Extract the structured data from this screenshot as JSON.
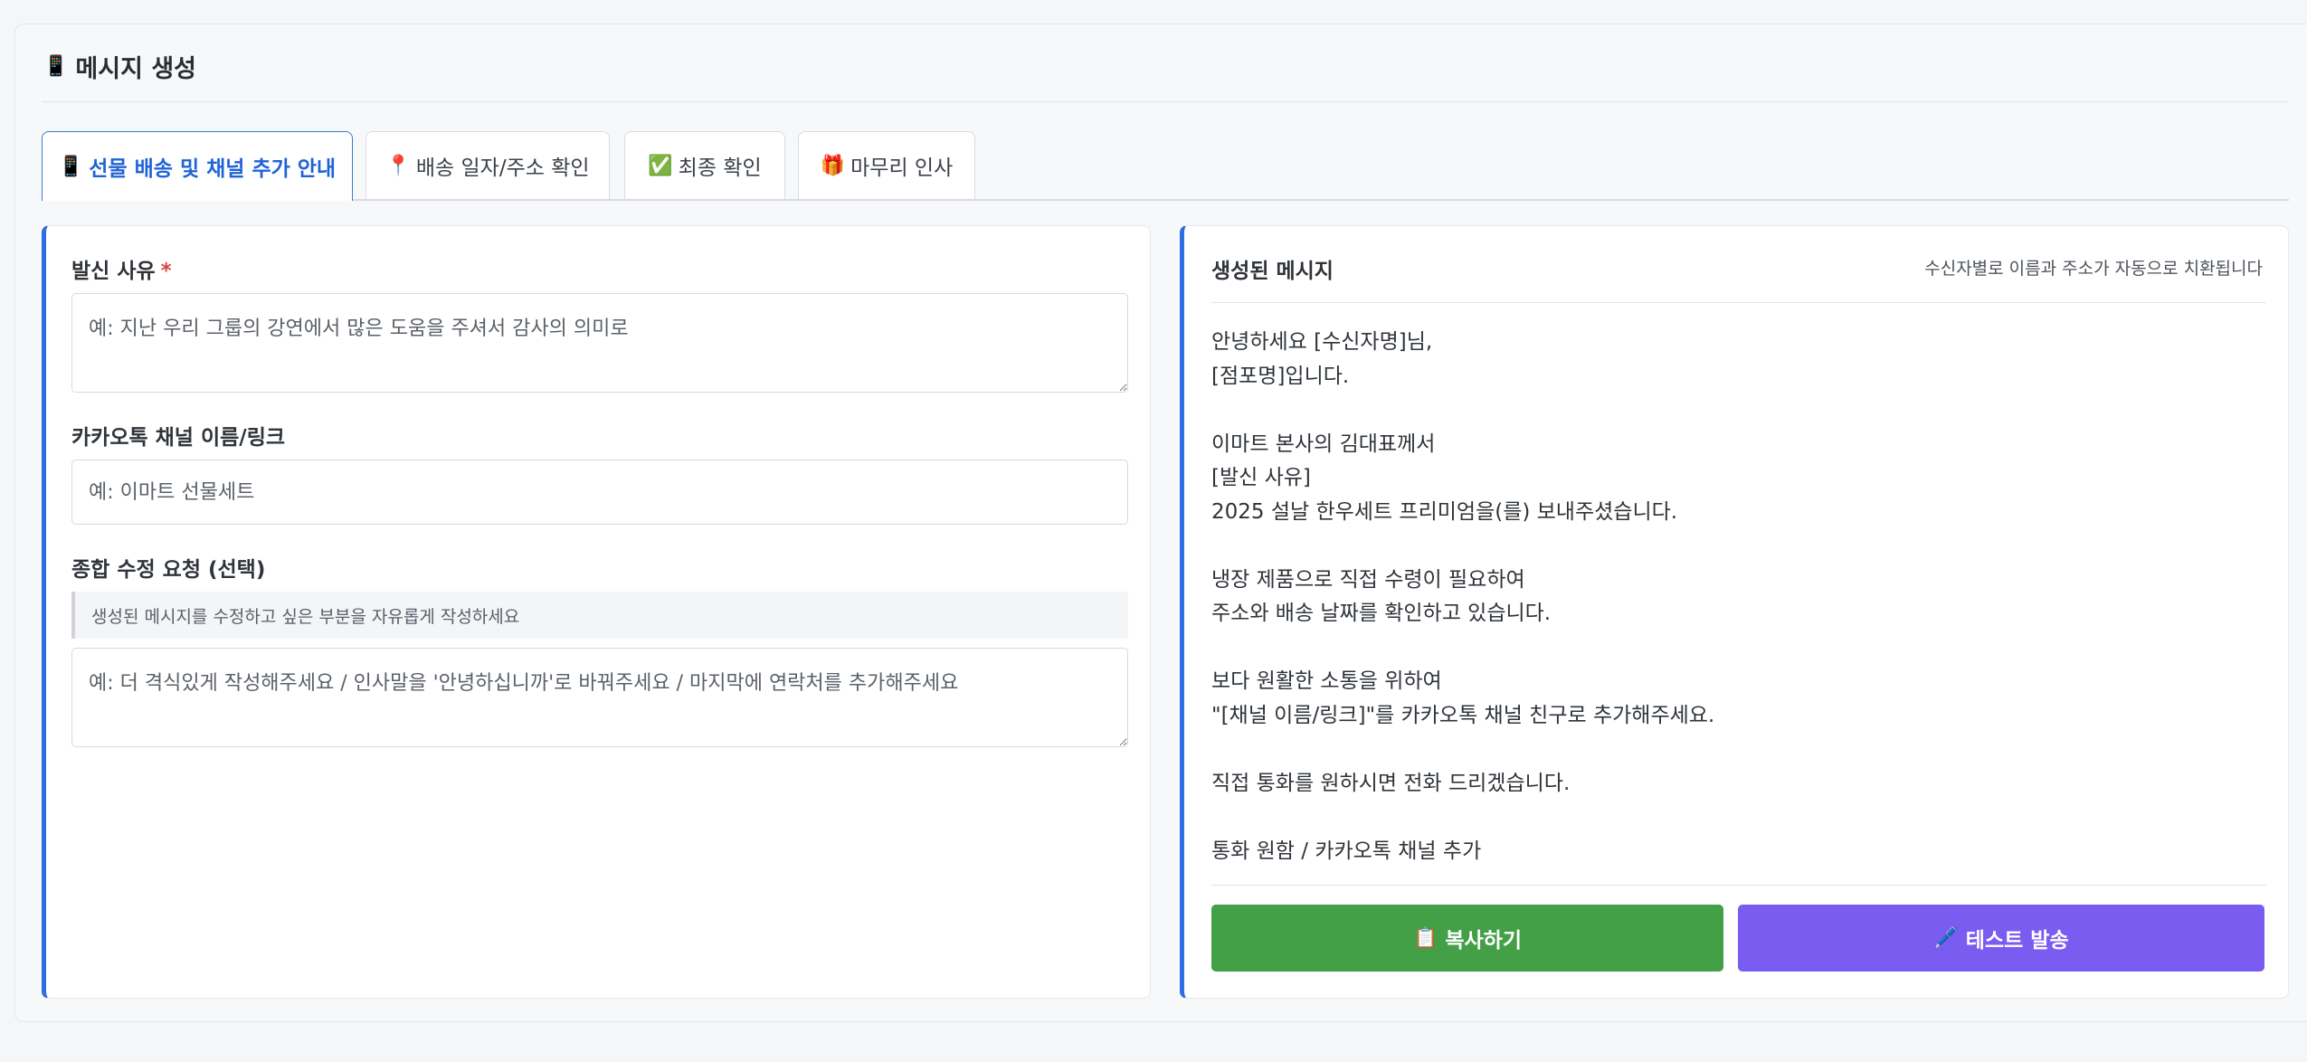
{
  "header": {
    "icon": "phone-icon",
    "title": "메시지 생성"
  },
  "tabs": [
    {
      "icon": "phone-icon",
      "label": "선물 배송 및 채널 추가 안내",
      "active": true
    },
    {
      "icon": "pin-icon",
      "label": "배송 일자/주소 확인",
      "active": false
    },
    {
      "icon": "check-icon",
      "label": "최종 확인",
      "active": false
    },
    {
      "icon": "gift-icon",
      "label": "마무리 인사",
      "active": false
    }
  ],
  "form": {
    "reason": {
      "label": "발신 사유",
      "required_mark": "*",
      "value": "",
      "placeholder": "예: 지난 우리 그룹의 강연에서 많은 도움을 주셔서 감사의 의미로"
    },
    "channel": {
      "label": "카카오톡 채널 이름/링크",
      "value": "",
      "placeholder": "예: 이마트 선물세트"
    },
    "revision": {
      "label": "종합 수정 요청 (선택)",
      "hint": "생성된 메시지를 수정하고 싶은 부분을 자유롭게 작성하세요",
      "value": "",
      "placeholder": "예: 더 격식있게 작성해주세요 / 인사말을 '안녕하십니까'로 바꿔주세요 / 마지막에 연락처를 추가해주세요"
    }
  },
  "generated": {
    "title": "생성된 메시지",
    "note": "수신자별로 이름과 주소가 자동으로 치환됩니다",
    "lines": [
      "안녕하세요 [수신자명]님,",
      "[점포명]입니다.",
      "",
      "이마트 본사의 김대표께서",
      "[발신 사유]",
      "2025 설날 한우세트 프리미엄을(를) 보내주셨습니다.",
      "",
      "냉장 제품으로 직접 수령이 필요하여",
      "주소와 배송 날짜를 확인하고 있습니다.",
      "",
      "보다 원활한 소통을 위하여",
      "\"[채널 이름/링크]\"를 카카오톡 채널 친구로 추가해주세요.",
      "",
      "직접 통화를 원하시면 전화 드리겠습니다.",
      "",
      "통화 원함 / 카카오톡 채널 추가"
    ]
  },
  "actions": {
    "copy": {
      "icon": "clipboard-icon",
      "label": "복사하기",
      "color": "#43a047"
    },
    "test_send": {
      "icon": "pencil-icon",
      "label": "테스트 발송",
      "color": "#7b5cf0"
    }
  },
  "colors": {
    "accent": "#2e6ee0",
    "active_tab_text": "#1f63d6",
    "required": "#d64545"
  }
}
